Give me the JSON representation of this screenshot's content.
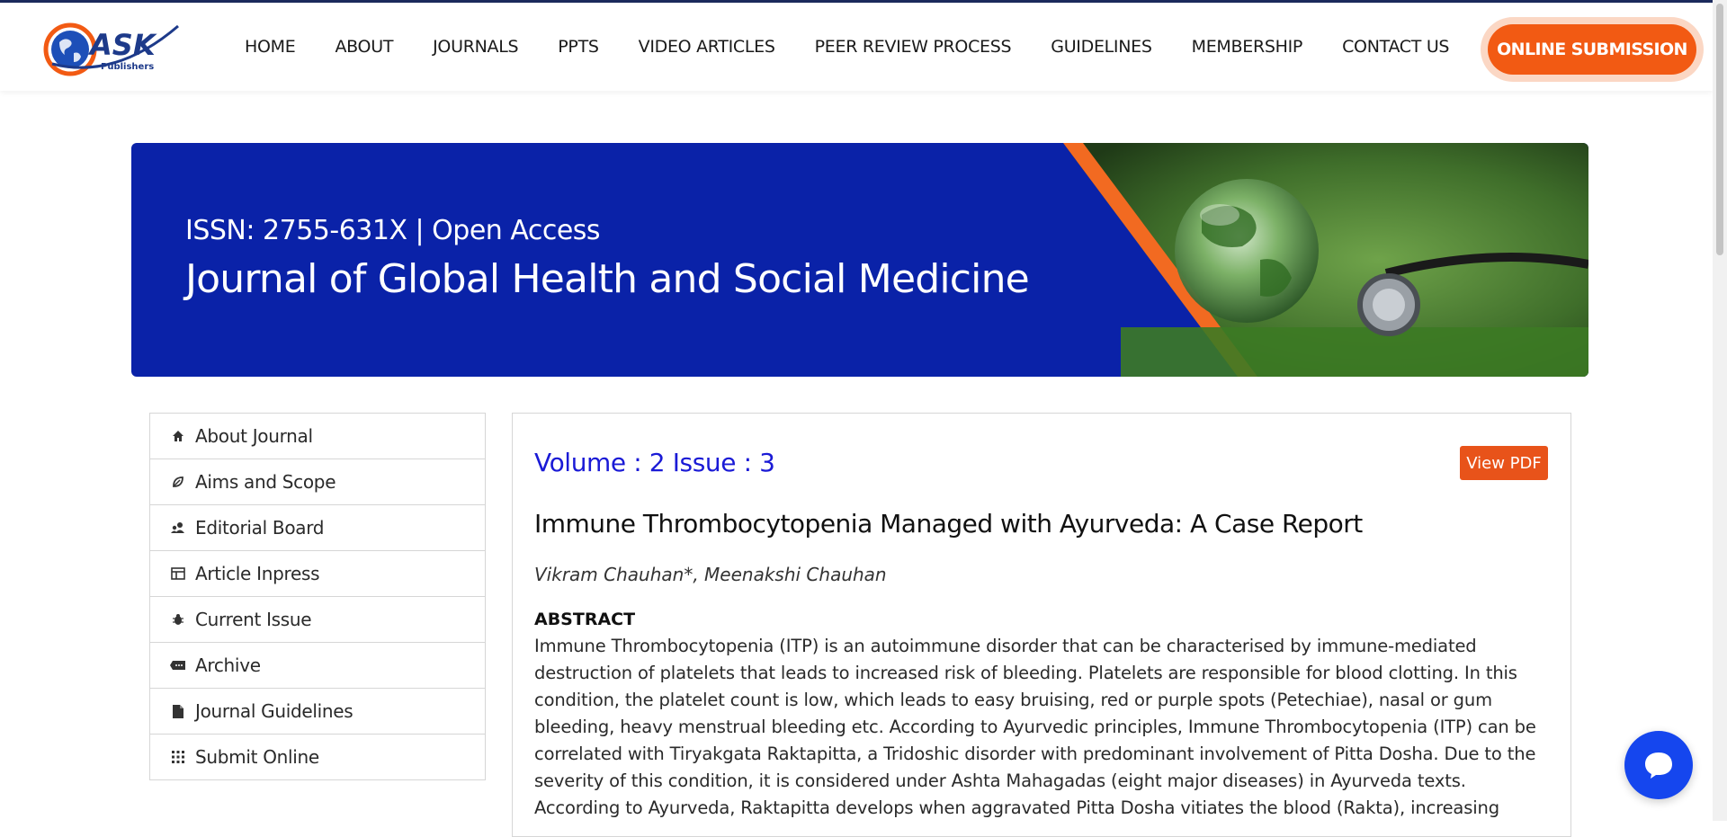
{
  "header": {
    "logo_text": "ASK",
    "logo_sub": "Publishers",
    "nav": [
      "HOME",
      "ABOUT",
      "JOURNALS",
      "PPTS",
      "VIDEO ARTICLES",
      "PEER REVIEW PROCESS",
      "GUIDELINES",
      "MEMBERSHIP",
      "CONTACT US"
    ],
    "submit_label": "ONLINE SUBMISSION"
  },
  "banner": {
    "issn": "ISSN: 2755-631X | Open Access",
    "title": "Journal of Global Health and Social Medicine"
  },
  "sidebar": {
    "items": [
      {
        "label": "About Journal",
        "icon": "home-icon"
      },
      {
        "label": "Aims and Scope",
        "icon": "leaf-icon"
      },
      {
        "label": "Editorial Board",
        "icon": "people-icon"
      },
      {
        "label": "Article Inpress",
        "icon": "table-icon"
      },
      {
        "label": "Current Issue",
        "icon": "bug-icon"
      },
      {
        "label": "Archive",
        "icon": "archive-icon"
      },
      {
        "label": "Journal Guidelines",
        "icon": "document-icon"
      },
      {
        "label": "Submit Online",
        "icon": "grid-icon"
      }
    ]
  },
  "article": {
    "volume": "Volume : 2 Issue : 3",
    "view_pdf": "View PDF",
    "title": "Immune Thrombocytopenia Managed with Ayurveda: A Case Report",
    "authors": "Vikram Chauhan*, Meenakshi Chauhan",
    "abstract_heading": "ABSTRACT",
    "abstract": "Immune Thrombocytopenia (ITP) is an autoimmune disorder that can be characterised by immune-mediated destruction of platelets that leads to increased risk of bleeding. Platelets are responsible for blood clotting. In this condition, the platelet count is low, which leads to easy bruising, red or purple spots (Petechiae), nasal or gum bleeding, heavy menstrual bleeding etc. According to Ayurvedic principles, Immune Thrombocytopenia (ITP) can be correlated with Tiryakgata Raktapitta, a Tridoshic disorder with predominant involvement of Pitta Dosha. Due to the severity of this condition, it is considered under Ashta Mahagadas (eight major diseases) in Ayurveda texts. According to Ayurveda, Raktapitta develops when aggravated Pitta Dosha vitiates the blood (Rakta), increasing"
  },
  "colors": {
    "brand_blue": "#0a22a8",
    "accent_orange": "#f25a13",
    "link_blue": "#1a1ad6",
    "chat_blue": "#1546ee"
  }
}
